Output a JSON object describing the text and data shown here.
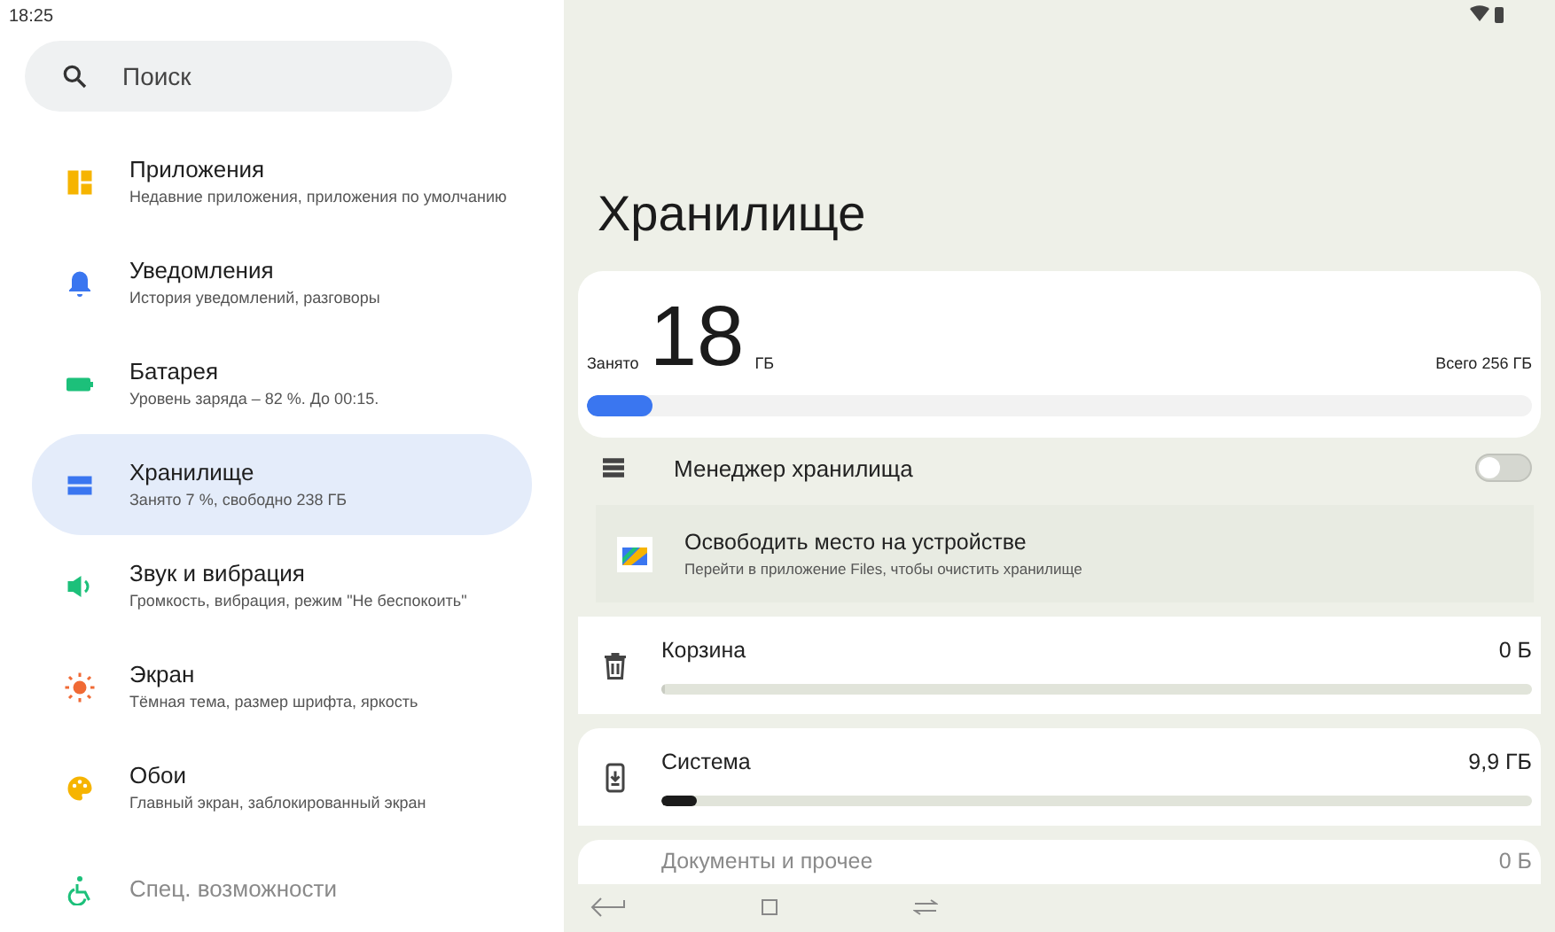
{
  "status_bar": {
    "time": "18:25"
  },
  "search": {
    "placeholder": "Поиск"
  },
  "sidebar": {
    "items": [
      {
        "kind": "apps",
        "title": "Приложения",
        "subtitle": "Недавние приложения, приложения по умолчанию",
        "selected": false
      },
      {
        "kind": "notifications",
        "title": "Уведомления",
        "subtitle": "История уведомлений, разговоры",
        "selected": false
      },
      {
        "kind": "battery",
        "title": "Батарея",
        "subtitle": "Уровень заряда – 82 %. До 00:15.",
        "selected": false
      },
      {
        "kind": "storage",
        "title": "Хранилище",
        "subtitle": "Занято 7 %, свободно 238 ГБ",
        "selected": true
      },
      {
        "kind": "sound",
        "title": "Звук и вибрация",
        "subtitle": "Громкость, вибрация, режим \"Не беспокоить\"",
        "selected": false
      },
      {
        "kind": "display",
        "title": "Экран",
        "subtitle": "Тёмная тема, размер шрифта, яркость",
        "selected": false
      },
      {
        "kind": "wallpaper",
        "title": "Обои",
        "subtitle": "Главный экран, заблокированный экран",
        "selected": false
      },
      {
        "kind": "accessibility",
        "title": "Спец. возможности",
        "selected": false
      }
    ]
  },
  "page": {
    "title": "Хранилище",
    "summary": {
      "used_label": "Занято",
      "used_value": "18",
      "used_unit": "ГБ",
      "total": "Всего 256 ГБ",
      "level": 0.07
    },
    "manager": {
      "label": "Менеджер хранилища",
      "on": false
    },
    "free_up": {
      "title": "Освободить место на устройстве",
      "subtitle": "Перейти в приложение Files, чтобы очистить хранилище"
    },
    "categories": [
      {
        "kind": "trash",
        "name": "Корзина",
        "size": "0 Б",
        "level": 0
      },
      {
        "kind": "system",
        "name": "Система",
        "size": "9,9 ГБ",
        "level": 0.04
      },
      {
        "kind": "documents",
        "name": "Документы и прочее",
        "size": "0 Б"
      }
    ]
  }
}
